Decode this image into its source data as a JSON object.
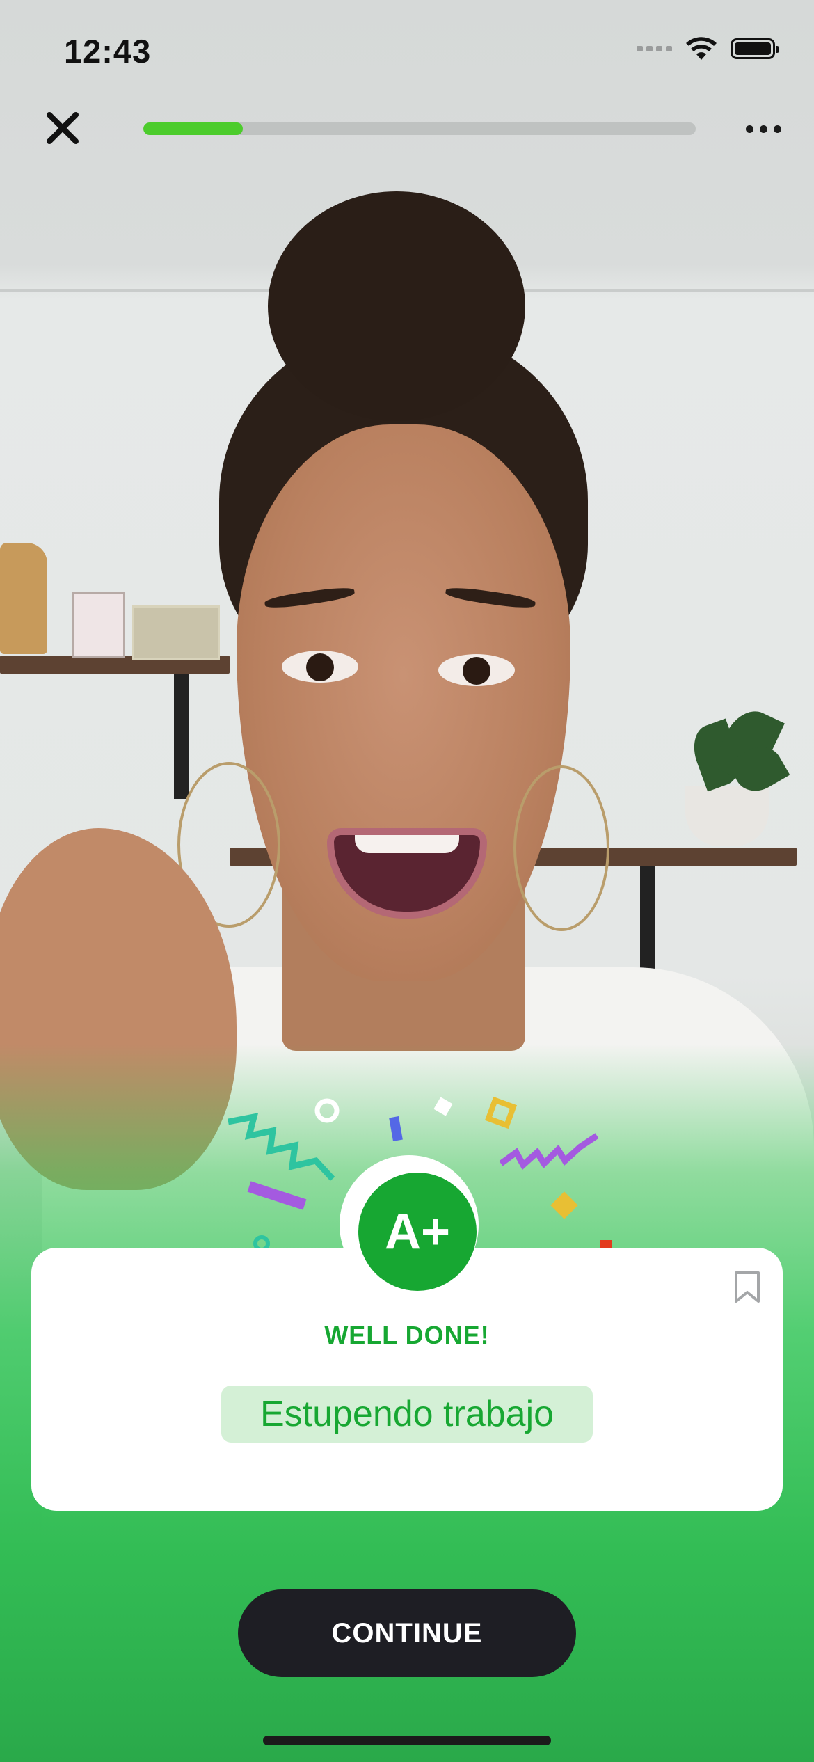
{
  "status_bar": {
    "time": "12:43",
    "icons": [
      "cellular-signal-icon",
      "wifi-icon",
      "battery-icon"
    ]
  },
  "lesson_header": {
    "close_icon": "close-icon",
    "more_icon": "more-options-icon",
    "progress_fraction": 0.18
  },
  "result_card": {
    "grade": "A+",
    "heading": "WELL DONE!",
    "phrase": "Estupendo trabajo",
    "bookmark_icon": "bookmark-icon"
  },
  "actions": {
    "continue_label": "CONTINUE"
  },
  "colors": {
    "accent_green": "#17a732",
    "progress_green": "#4ccc2c",
    "phrase_bg": "#d4f0d6",
    "button_dark": "#1e1e24"
  }
}
